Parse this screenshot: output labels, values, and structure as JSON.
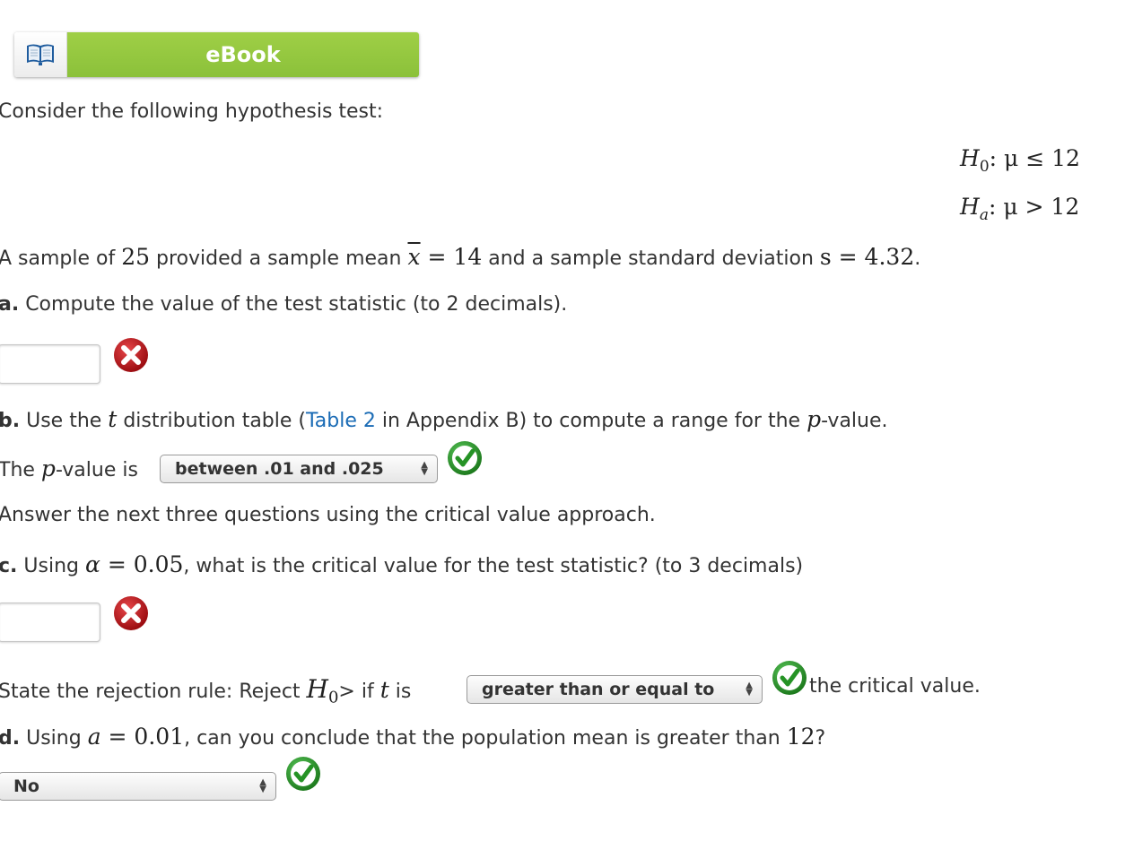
{
  "ebook": {
    "label": "eBook",
    "icon": "open-book-icon"
  },
  "intro": "Consider the following hypothesis test:",
  "hypotheses": {
    "h0": {
      "symbol": "H",
      "sub": "0",
      "rel": ": μ ≤ 12"
    },
    "ha": {
      "symbol": "H",
      "sub": "a",
      "rel": ": μ > 12"
    }
  },
  "sample_sentence": {
    "p1": "A sample of ",
    "n": "25",
    "p2": " provided a sample mean ",
    "xbar": "x",
    "eq1": " = 14",
    "p3": " and a sample standard deviation ",
    "s": "s = 4.32",
    "p4": "."
  },
  "part_a": {
    "letter": "a.",
    "text": " Compute the value of the test statistic (to 2 decimals).",
    "input_value": "",
    "status": "incorrect"
  },
  "part_b": {
    "letter": "b.",
    "t1": " Use the ",
    "t_sym": "t",
    "t2": " distribution table (",
    "link": "Table 2",
    "t3": " in Appendix B) to compute a range for the ",
    "p_sym": "p",
    "t4": "-value.",
    "answer_prefix1": "The ",
    "answer_p": "p",
    "answer_prefix2": "-value is ",
    "select_value": "between .01 and .025",
    "status": "correct"
  },
  "critical_intro": "Answer the next three questions using the critical value approach.",
  "part_c": {
    "letter": "c.",
    "t1": " Using ",
    "alpha": "α",
    "eq": " = 0.05",
    "t2": ", what is the critical value for the test statistic? (to 3 decimals)",
    "input_value": "",
    "status": "incorrect"
  },
  "rejection_rule": {
    "t1": "State the rejection rule: Reject ",
    "h": "H",
    "sub": "0",
    "t2": "> if ",
    "t_sym": "t",
    "t3": " is ",
    "select_value": "greater than or equal to",
    "status": "correct",
    "t4": " the critical value."
  },
  "part_d": {
    "letter": "d.",
    "t1": " Using ",
    "a": "a",
    "eq": " = 0.01",
    "t2": ", can you conclude that the population mean is greater than ",
    "num": "12",
    "t3": "?",
    "select_value": "No",
    "status": "correct"
  },
  "colors": {
    "ebook_green": "#8bc13a",
    "link_blue": "#1a6bb5",
    "correct_green": "#2e9a2e",
    "incorrect_red": "#c0171b"
  }
}
